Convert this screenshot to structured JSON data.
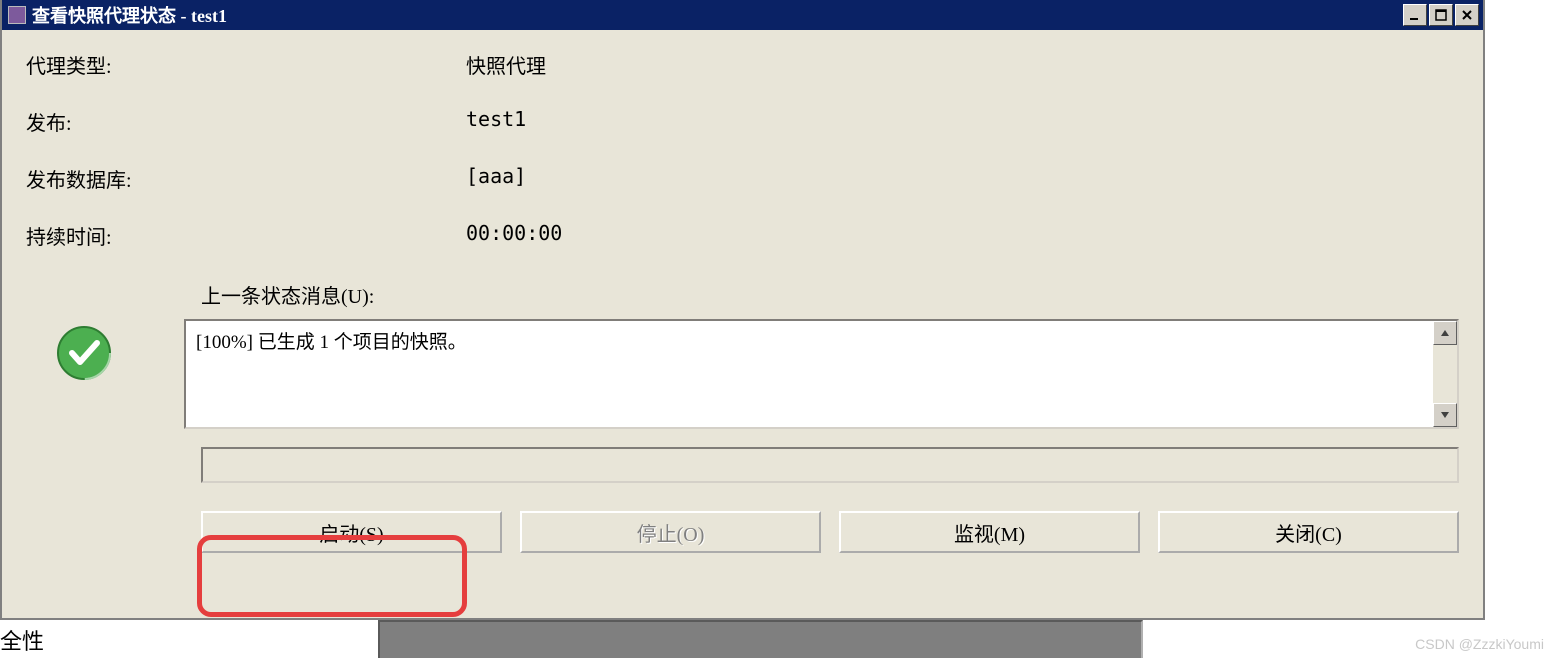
{
  "titlebar": {
    "title": "查看快照代理状态 - test1"
  },
  "info": {
    "agent_type_label": "代理类型:",
    "agent_type_value": "快照代理",
    "publication_label": "发布:",
    "publication_value": "test1",
    "database_label": "发布数据库:",
    "database_value": "[aaa]",
    "duration_label": "持续时间:",
    "duration_value": "00:00:00"
  },
  "status": {
    "last_message_label": "上一条状态消息(U):",
    "message": "[100%] 已生成 1 个项目的快照。"
  },
  "buttons": {
    "start": "启动(S)",
    "stop": "停止(O)",
    "monitor": "监视(M)",
    "close": "关闭(C)"
  },
  "fragment": {
    "text": "全性"
  },
  "watermark": "CSDN @ZzzkiYoumi"
}
